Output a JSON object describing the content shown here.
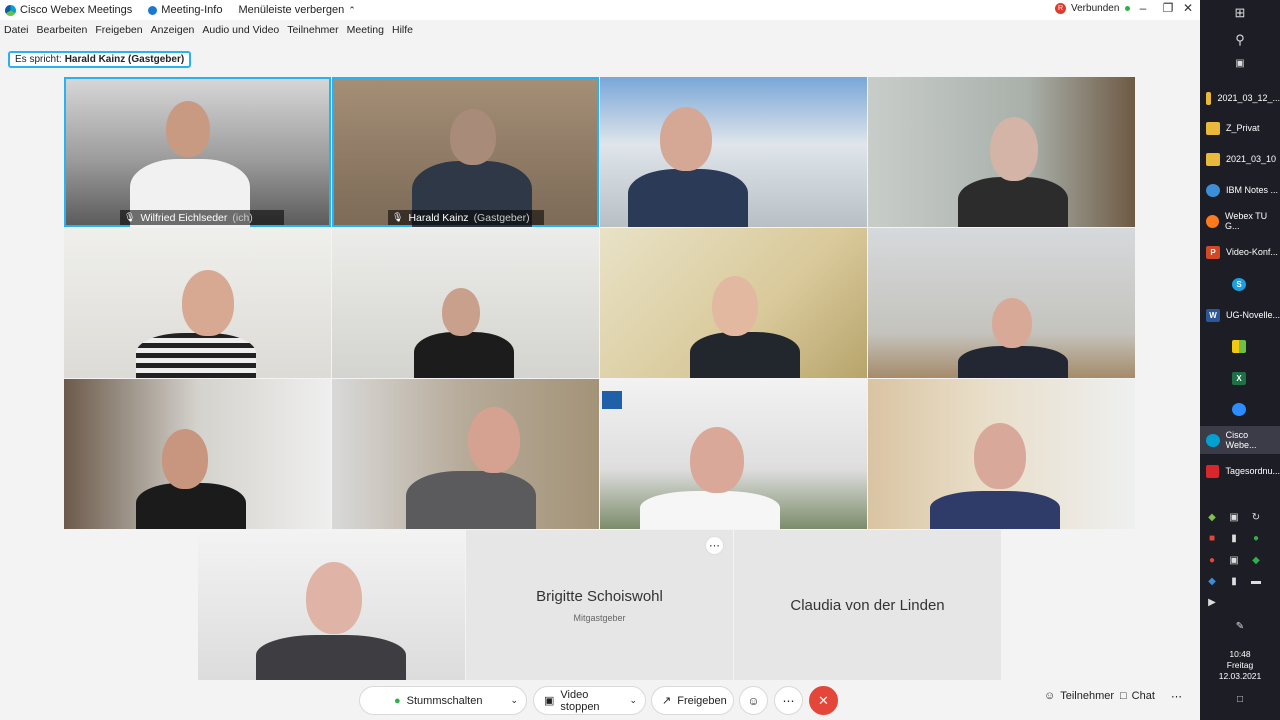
{
  "window": {
    "app_title": "Cisco Webex Meetings",
    "meeting_info": "Meeting-Info",
    "hide_menu": "Menüleiste verbergen",
    "status": "Verbunden",
    "rec_badge": "R"
  },
  "menu": [
    "Datei",
    "Bearbeiten",
    "Freigeben",
    "Anzeigen",
    "Audio und Video",
    "Teilnehmer",
    "Meeting",
    "Hilfe"
  ],
  "speaker": {
    "prefix": "Es spricht:",
    "name": "Harald Kainz (Gastgeber)"
  },
  "participants": [
    {
      "name": "Wilfried Eichlseder",
      "role": "(ich)"
    },
    {
      "name": "Harald Kainz",
      "role": "(Gastgeber)"
    }
  ],
  "avatar_tiles": [
    {
      "name": "Brigitte Schoiswohl",
      "role": "Mitgastgeber"
    },
    {
      "name": "Claudia von der Linden",
      "role": ""
    }
  ],
  "controls": {
    "mute": "Stummschalten",
    "video": "Video stoppen",
    "share": "Freigeben",
    "participants": "Teilnehmer",
    "chat": "Chat"
  },
  "taskbar": {
    "items": [
      "2021_03_12_...",
      "Z_Privat",
      "2021_03_10",
      "IBM Notes ...",
      "Webex TU G...",
      "Video-Konf...",
      "UG-Novelle...",
      "Cisco Webe...",
      "Tagesordnu..."
    ],
    "icon_letters": [
      "P",
      "S",
      "W",
      "X"
    ],
    "time": "10:48",
    "day": "Freitag",
    "date": "12.03.2021"
  },
  "colors": {
    "accent": "#2ab2f0",
    "end_call": "#e5463a",
    "taskbar": "#1d1d26"
  }
}
